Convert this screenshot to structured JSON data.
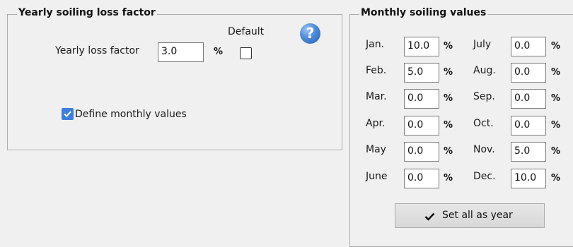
{
  "yearly": {
    "legend": "Yearly soiling loss factor",
    "default_label": "Default",
    "factor_label": "Yearly loss factor",
    "factor_value": "3.0",
    "percent": "%",
    "default_checked": false,
    "define_monthly_label": "Define monthly values",
    "define_monthly_checked": true,
    "help_icon": "?"
  },
  "monthly": {
    "legend": "Monthly soiling values",
    "percent": "%",
    "months": [
      {
        "label": "Jan.",
        "value": "10.0"
      },
      {
        "label": "Feb.",
        "value": "5.0"
      },
      {
        "label": "Mar.",
        "value": "0.0"
      },
      {
        "label": "Apr.",
        "value": "0.0"
      },
      {
        "label": "May",
        "value": "0.0"
      },
      {
        "label": "June",
        "value": "0.0"
      },
      {
        "label": "July",
        "value": "0.0"
      },
      {
        "label": "Aug.",
        "value": "0.0"
      },
      {
        "label": "Sep.",
        "value": "0.0"
      },
      {
        "label": "Oct.",
        "value": "0.0"
      },
      {
        "label": "Nov.",
        "value": "5.0"
      },
      {
        "label": "Dec.",
        "value": "10.0"
      }
    ],
    "set_all_label": "Set all as year"
  },
  "colors": {
    "accent": "#3f7fdc",
    "background": "#f0f0f0",
    "border": "#adadad"
  }
}
